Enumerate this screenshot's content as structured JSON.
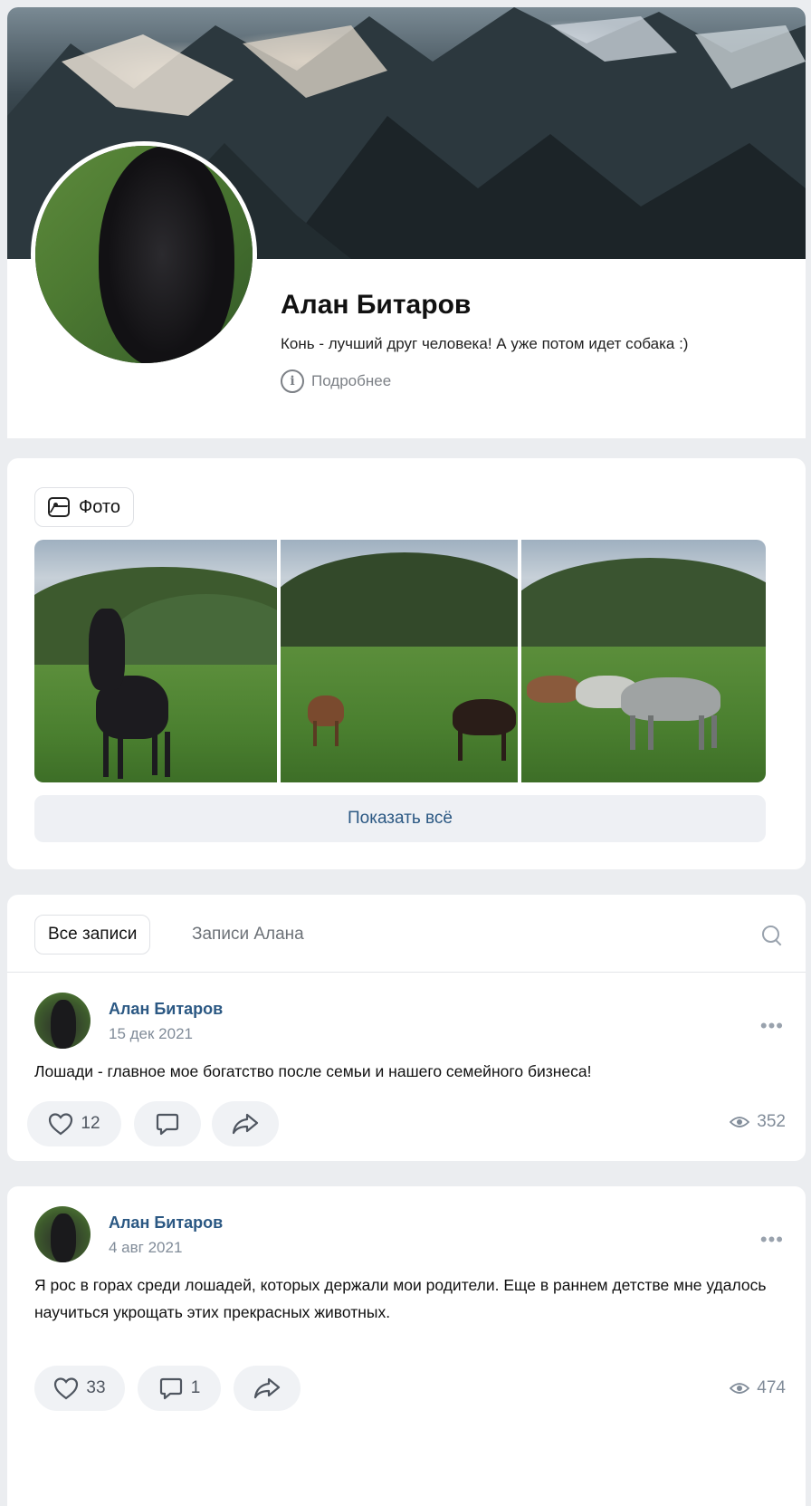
{
  "profile": {
    "name": "Алан Битаров",
    "status": "Конь - лучший друг человека! А уже потом идет собака :)",
    "details_label": "Подробнее"
  },
  "photos": {
    "chip_label": "Фото",
    "show_all_label": "Показать всё"
  },
  "tabs": {
    "all_posts": "Все записи",
    "own_posts": "Записи Алана"
  },
  "posts": [
    {
      "author": "Алан Битаров",
      "date": "15 дек 2021",
      "text": "Лошади - главное мое богатство после семьи и нашего семейного бизнеса!",
      "likes": "12",
      "comments": "",
      "views": "352"
    },
    {
      "author": "Алан Битаров",
      "date": "4 авг 2021",
      "text": "Я рос в горах среди лошадей, которых держали мои родители. Еще в раннем детстве мне удалось научиться укрощать этих прекрасных животных.",
      "likes": "33",
      "comments": "1",
      "views": "474"
    }
  ],
  "colors": {
    "link": "#2b5883",
    "muted": "#818c99",
    "background": "#ebedf0",
    "button_bg": "#f0f2f5"
  },
  "icons": [
    "info-icon",
    "image-icon",
    "search-icon",
    "heart-icon",
    "comment-icon",
    "share-icon",
    "eye-icon",
    "more-icon"
  ]
}
